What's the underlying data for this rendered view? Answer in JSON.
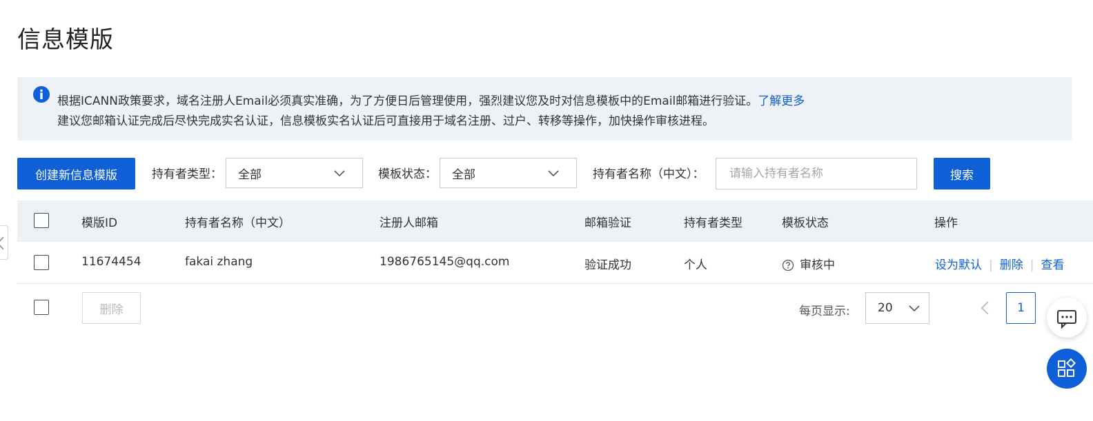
{
  "page": {
    "title": "信息模版"
  },
  "notice": {
    "line1": "根据ICANN政策要求，域名注册人Email必须真实准确，为了方便日后管理使用，强烈建议您及时对信息模板中的Email邮箱进行验证。",
    "learn_more": "了解更多",
    "line2": "建议您邮箱认证完成后尽快完成实名认证，信息模板实名认证后可直接用于域名注册、过户、转移等操作，加快操作审核进程。",
    "icon": "info-icon"
  },
  "toolbar": {
    "create_label": "创建新信息模版",
    "holder_type_label": "持有者类型：",
    "holder_type_value": "全部",
    "template_status_label": "模板状态：",
    "template_status_value": "全部",
    "holder_name_label": "持有者名称（中文）：",
    "holder_name_placeholder": "请输入持有者名称",
    "holder_name_value": "",
    "search_label": "搜索"
  },
  "table": {
    "headers": [
      "模版ID",
      "持有者名称（中文）",
      "注册人邮箱",
      "邮箱验证",
      "持有者类型",
      "模板状态",
      "操作"
    ],
    "rows": [
      {
        "id": "11674454",
        "holder_name": "fakai zhang",
        "email": "1986765145@qq.com",
        "email_verify": "验证成功",
        "holder_type": "个人",
        "status": "审核中",
        "status_icon": "question-circle-icon",
        "actions": [
          "设为默认",
          "删除",
          "查看"
        ]
      }
    ]
  },
  "footer": {
    "bulk_delete_label": "删除",
    "per_page_label": "每页显示:",
    "per_page_value": "20",
    "current_page": "1"
  },
  "colors": {
    "primary": "#0e5fd8",
    "panel_bg": "#eef1f6",
    "border": "#c7cbd1"
  }
}
